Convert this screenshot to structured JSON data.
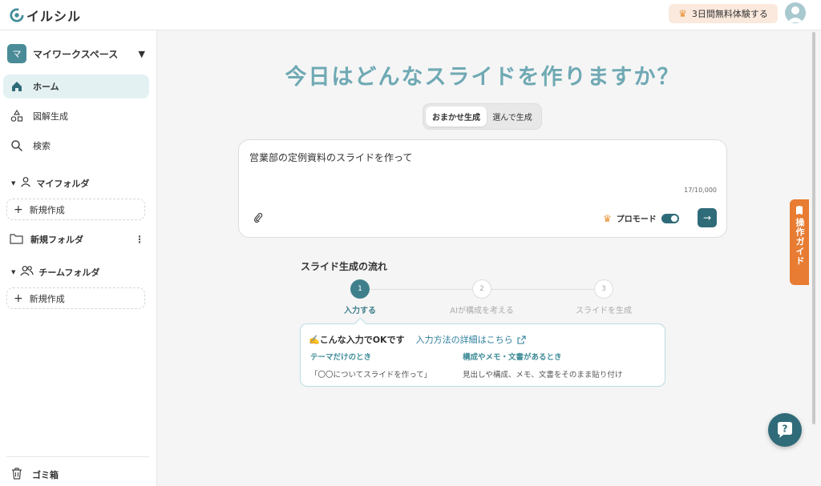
{
  "app": {
    "logo_text": "イルシル"
  },
  "header": {
    "trial_label": "3日間無料体験する",
    "avatar_icon": "user-avatar-icon"
  },
  "sidebar": {
    "workspace": {
      "badge": "マ",
      "name": "マイワークスペース"
    },
    "nav": [
      {
        "label": "ホーム",
        "icon": "home-icon",
        "active": true
      },
      {
        "label": "図解生成",
        "icon": "shapes-icon",
        "active": false
      },
      {
        "label": "検索",
        "icon": "search-icon",
        "active": false
      }
    ],
    "my_folder": {
      "label": "マイフォルダ",
      "new_label": "新規作成"
    },
    "folders": [
      {
        "label": "新規フォルダ"
      }
    ],
    "team_folder": {
      "label": "チームフォルダ",
      "new_label": "新規作成"
    },
    "trash_label": "ゴミ箱"
  },
  "main": {
    "title": "今日はどんなスライドを作りますか？",
    "modes": [
      "おまかせ生成",
      "選んで生成"
    ],
    "input": {
      "value": "営業部の定例資料のスライドを作って",
      "char_count": "17/10,000"
    },
    "pro_mode_label": "プロモード",
    "pro_mode_on": true,
    "flow": {
      "title": "スライド生成の流れ",
      "steps": [
        {
          "num": "1",
          "label": "入力する"
        },
        {
          "num": "2",
          "label": "AIが構成を考える"
        },
        {
          "num": "3",
          "label": "スライドを生成"
        }
      ],
      "current_step": 1
    },
    "tip": {
      "title": "✍️こんな入力でOKです",
      "link": "入力方法の詳細はこちら",
      "columns": [
        {
          "heading": "テーマだけのとき",
          "text": "「〇〇についてスライドを作って」"
        },
        {
          "heading": "構成やメモ・文書があるとき",
          "text": "見出しや構成、メモ、文書をそのまま貼り付け"
        }
      ]
    }
  },
  "guide_tab": {
    "label": "操作ガイド"
  },
  "colors": {
    "accent": "#2f6b78",
    "title": "#6fa9b4",
    "guide": "#e87c32"
  }
}
